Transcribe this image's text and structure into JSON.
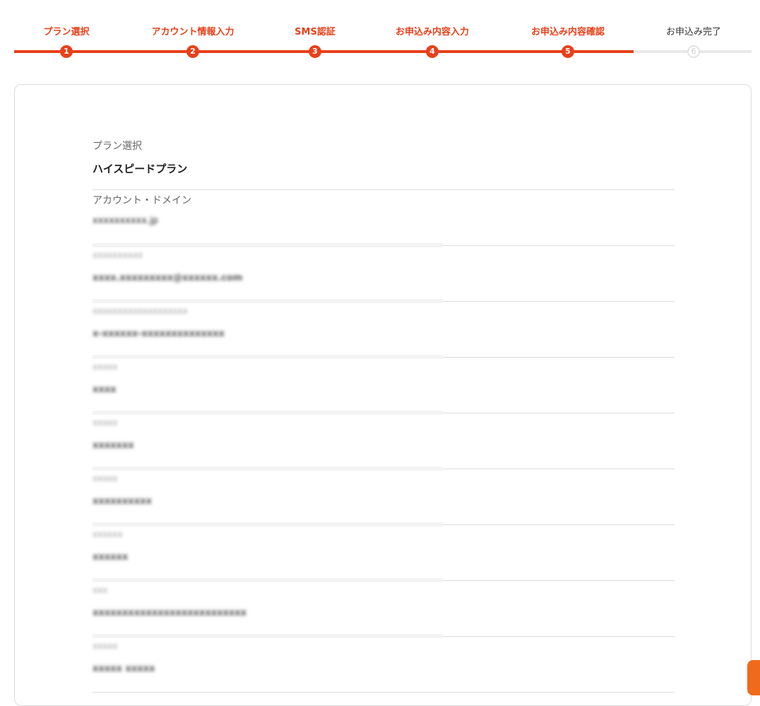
{
  "stepper": {
    "progress_fraction": 0.84,
    "steps": [
      {
        "number": "1",
        "label": "プラン選択",
        "status": "done"
      },
      {
        "number": "2",
        "label": "アカウント情報入力",
        "status": "done"
      },
      {
        "number": "3",
        "label": "SMS認証",
        "status": "done"
      },
      {
        "number": "4",
        "label": "お申込み内容入力",
        "status": "done"
      },
      {
        "number": "5",
        "label": "お申込み内容確認",
        "status": "current"
      },
      {
        "number": "6",
        "label": "お申込み完了",
        "status": "pending"
      }
    ]
  },
  "summary": {
    "rows": [
      {
        "label": "プラン選択",
        "value": "ハイスピードプラン"
      },
      {
        "label": "アカウント・ドメイン",
        "value": "xxxxxxxxxx.jp"
      },
      {
        "label": "xxxxxxxxxx",
        "value": "xxxx.xxxxxxxxx@xxxxxx.com"
      },
      {
        "label": "xxxxxxxxxxxxxxxxxxx",
        "value": "x-xxxxxx-xxxxxxxxxxxxxx"
      },
      {
        "label": "xxxxx",
        "value": "xxxx"
      },
      {
        "label": "xxxxx",
        "value": "xxxxxxx"
      },
      {
        "label": "xxxxx",
        "value": "xxxxxxxxxx"
      },
      {
        "label": "xxxxxx",
        "value": "xxxxxx"
      },
      {
        "label": "xxx",
        "value": "xxxxxxxxxxxxxxxxxxxxxxxxxx"
      },
      {
        "label": "xxxxx",
        "value": "xxxxx xxxxx"
      }
    ]
  },
  "colors": {
    "accent": "#e8401a",
    "pending": "#e3e3e3",
    "help_tab": "#f06a1b"
  }
}
